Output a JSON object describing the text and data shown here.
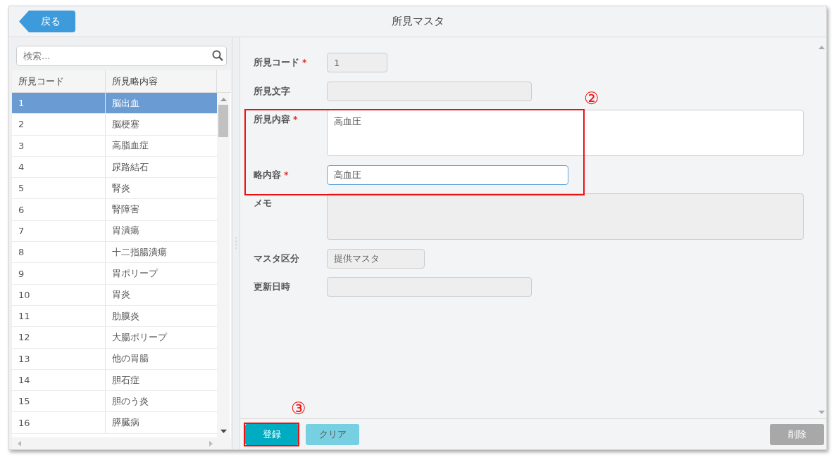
{
  "header": {
    "back_button": "戻る",
    "title": "所見マスタ"
  },
  "search": {
    "placeholder": "検索..."
  },
  "table": {
    "columns": [
      "所見コード",
      "所見略内容"
    ],
    "rows": [
      {
        "code": "1",
        "name": "脳出血",
        "selected": true
      },
      {
        "code": "2",
        "name": "脳梗塞",
        "selected": false
      },
      {
        "code": "3",
        "name": "高脂血症",
        "selected": false
      },
      {
        "code": "4",
        "name": "尿路結石",
        "selected": false
      },
      {
        "code": "5",
        "name": "腎炎",
        "selected": false
      },
      {
        "code": "6",
        "name": "腎障害",
        "selected": false
      },
      {
        "code": "7",
        "name": "胃潰瘍",
        "selected": false
      },
      {
        "code": "8",
        "name": "十二指腸潰瘍",
        "selected": false
      },
      {
        "code": "9",
        "name": "胃ポリープ",
        "selected": false
      },
      {
        "code": "10",
        "name": "胃炎",
        "selected": false
      },
      {
        "code": "11",
        "name": "肋膜炎",
        "selected": false
      },
      {
        "code": "12",
        "name": "大腸ポリープ",
        "selected": false
      },
      {
        "code": "13",
        "name": "他の胃腸",
        "selected": false
      },
      {
        "code": "14",
        "name": "胆石症",
        "selected": false
      },
      {
        "code": "15",
        "name": "胆のう炎",
        "selected": false
      },
      {
        "code": "16",
        "name": "膵臓病",
        "selected": false
      }
    ]
  },
  "form": {
    "fields": [
      {
        "label": "所見コード",
        "required_mark": "*",
        "value": "1",
        "kind": "input",
        "disabled": true,
        "focused": false
      },
      {
        "label": "所見文字",
        "kind": "input",
        "disabled": true,
        "focused": false
      },
      {
        "label": "所見内容",
        "required_mark": "*",
        "value": "高血圧",
        "kind": "textarea",
        "disabled": false,
        "focused": false
      },
      {
        "label": "略内容",
        "required_mark": "*",
        "value": "高血圧",
        "kind": "input",
        "disabled": false,
        "focused": true
      },
      {
        "label": "メモ",
        "kind": "textarea",
        "disabled": true,
        "focused": false
      },
      {
        "label": "マスタ区分",
        "value": "提供マスタ",
        "kind": "input",
        "disabled": true,
        "focused": false
      },
      {
        "label": "更新日時",
        "kind": "input",
        "disabled": true,
        "focused": false
      }
    ]
  },
  "footer": {
    "buttons": [
      {
        "label": "登録",
        "kind": "primary"
      },
      {
        "label": "クリア",
        "kind": "secondary"
      },
      {
        "label": "削除",
        "kind": "danger"
      }
    ]
  },
  "annotations": [
    {
      "label": "②"
    },
    {
      "label": "③"
    }
  ]
}
